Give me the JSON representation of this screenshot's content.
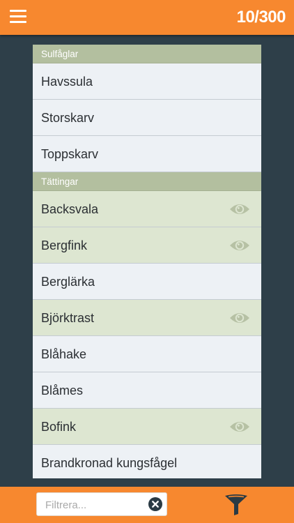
{
  "header": {
    "counter": "10/300",
    "menu_icon": "hamburger-menu-icon"
  },
  "colors": {
    "accent": "#f7882f",
    "background": "#2e3f49",
    "section_header": "#b3bf9f",
    "row": "#edf1f5",
    "row_seen": "#dde6d1"
  },
  "sections": [
    {
      "title": "Sulfåglar",
      "items": [
        {
          "name": "Havssula",
          "seen": false
        },
        {
          "name": "Storskarv",
          "seen": false
        },
        {
          "name": "Toppskarv",
          "seen": false
        }
      ]
    },
    {
      "title": "Tättingar",
      "items": [
        {
          "name": "Backsvala",
          "seen": true
        },
        {
          "name": "Bergfink",
          "seen": true
        },
        {
          "name": "Berglärka",
          "seen": false
        },
        {
          "name": "Björktrast",
          "seen": true
        },
        {
          "name": "Blåhake",
          "seen": false
        },
        {
          "name": "Blåmes",
          "seen": false
        },
        {
          "name": "Bofink",
          "seen": true
        },
        {
          "name": "Brandkronad kungsfågel",
          "seen": false
        }
      ]
    }
  ],
  "footer": {
    "filter_placeholder": "Filtrera...",
    "filter_value": "",
    "clear_icon": "clear-circle-icon",
    "filter_icon": "funnel-icon"
  }
}
